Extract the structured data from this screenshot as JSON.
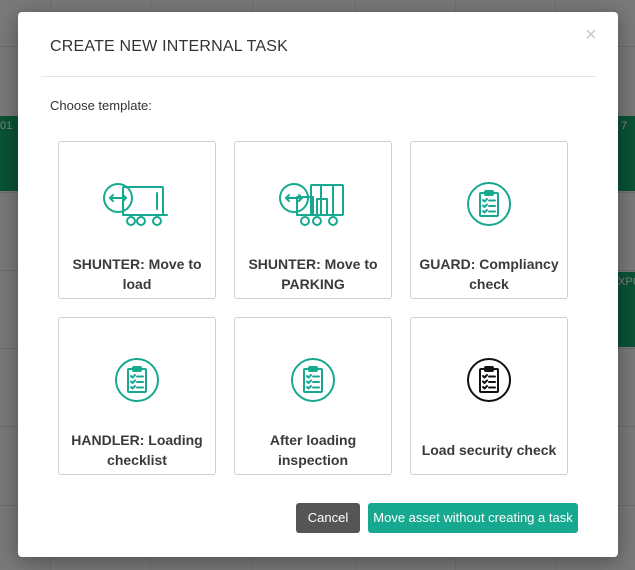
{
  "background": {
    "cell_texts": [
      "01",
      "7",
      "XPC"
    ]
  },
  "modal": {
    "title": "CREATE NEW INTERNAL TASK",
    "close_glyph": "×",
    "choose_label": "Choose template:",
    "templates": [
      {
        "label": "SHUNTER: Move to load",
        "icon": "truck-move-icon",
        "color": "#17a98f"
      },
      {
        "label": "SHUNTER: Move to PARKING",
        "icon": "truck-parking-icon",
        "color": "#17a98f"
      },
      {
        "label": "GUARD: Compliancy check",
        "icon": "clipboard-check-icon",
        "color": "#17a98f"
      },
      {
        "label": "HANDLER: Loading checklist",
        "icon": "clipboard-check-icon",
        "color": "#17a98f"
      },
      {
        "label": "After loading inspection",
        "icon": "clipboard-check-icon",
        "color": "#17a98f"
      },
      {
        "label": "Load security check",
        "icon": "clipboard-check-icon",
        "color": "#111111"
      }
    ],
    "buttons": {
      "cancel": "Cancel",
      "move_asset": "Move asset without creating a task"
    }
  },
  "colors": {
    "accent": "#17a98f",
    "cancel_bg": "#555555",
    "status_green": "#17a56b"
  }
}
